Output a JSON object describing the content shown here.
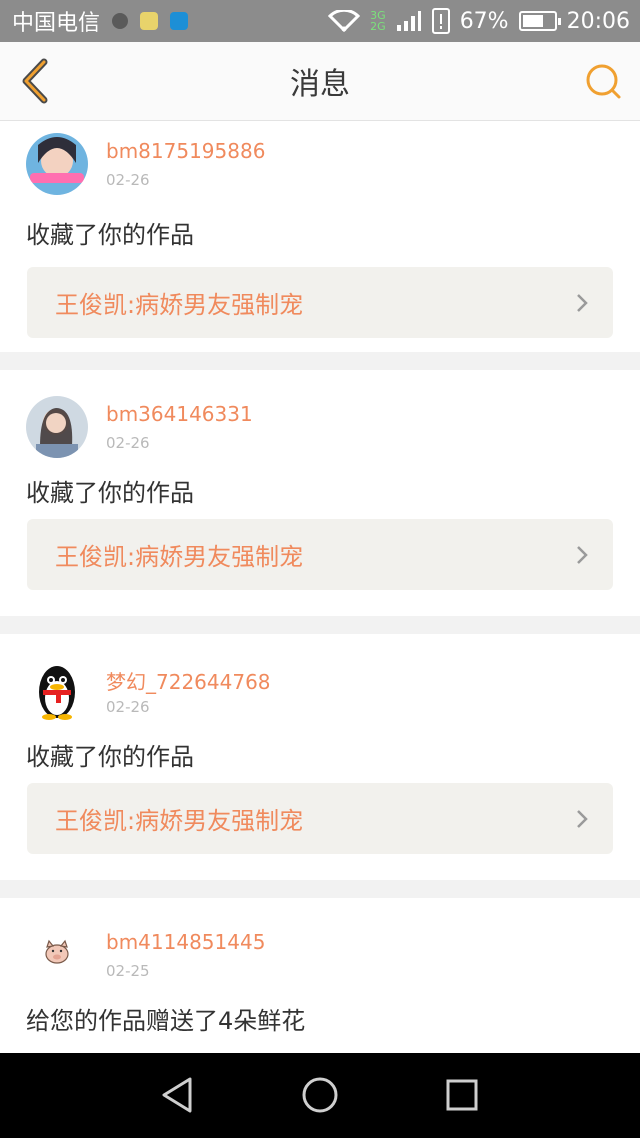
{
  "status_bar": {
    "carrier": "中国电信",
    "network_top": "3G",
    "network_bottom": "2G",
    "battery_text": "67%",
    "battery_level": 0.67,
    "time": "20:06"
  },
  "header": {
    "title": "消息",
    "back_icon": "chevron-left-icon",
    "search_icon": "search-icon",
    "accent": "#f0a030"
  },
  "messages": [
    {
      "user": "bm8175195886",
      "date": "02-26",
      "action": "收藏了你的作品",
      "work": "王俊凯:病娇男友强制宠"
    },
    {
      "user": "bm364146331",
      "date": "02-26",
      "action": "收藏了你的作品",
      "work": "王俊凯:病娇男友强制宠"
    },
    {
      "user": "梦幻_722644768",
      "date": "02-26",
      "action": "收藏了你的作品",
      "work": "王俊凯:病娇男友强制宠"
    },
    {
      "user": "bm4114851445",
      "date": "02-25",
      "action": "给您的作品赠送了4朵鲜花"
    }
  ],
  "colors": {
    "name": "#f08a5d",
    "date": "#b9b9b9"
  }
}
